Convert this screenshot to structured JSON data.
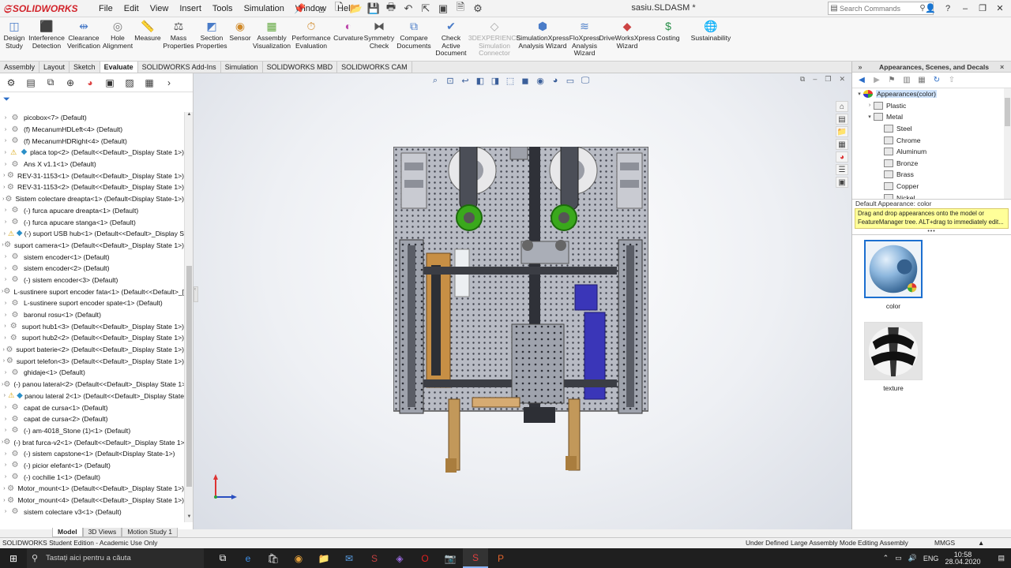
{
  "app": {
    "logo_text": "SOLIDWORKS",
    "document_title": "sasiu.SLDASM *",
    "menu": [
      "File",
      "Edit",
      "View",
      "Insert",
      "Tools",
      "Simulation",
      "Window",
      "Help"
    ],
    "search_placeholder": "Search Commands"
  },
  "ribbon": {
    "buttons": [
      {
        "label": "Design Study",
        "icon": "design-study-icon"
      },
      {
        "label": "Interference Detection",
        "icon": "interference-icon"
      },
      {
        "label": "Clearance Verification",
        "icon": "clearance-icon"
      },
      {
        "label": "Hole Alignment",
        "icon": "hole-icon"
      },
      {
        "label": "Measure",
        "icon": "measure-icon"
      },
      {
        "label": "Mass Properties",
        "icon": "mass-icon"
      },
      {
        "label": "Section Properties",
        "icon": "section-icon"
      },
      {
        "label": "Sensor",
        "icon": "sensor-icon"
      },
      {
        "label": "Assembly Visualization",
        "icon": "assembly-vis-icon"
      },
      {
        "label": "Performance Evaluation",
        "icon": "performance-icon"
      },
      {
        "label": "Curvature",
        "icon": "curvature-icon"
      },
      {
        "label": "Symmetry Check",
        "icon": "symmetry-icon"
      },
      {
        "label": "Compare Documents",
        "icon": "compare-icon"
      },
      {
        "label": "Check Active Document",
        "icon": "check-icon"
      },
      {
        "label": "3DEXPERIENCE Simulation Connector",
        "icon": "3dx-icon",
        "disabled": true
      },
      {
        "label": "SimulationXpress Analysis Wizard",
        "icon": "simxpress-icon"
      },
      {
        "label": "FloXpress Analysis Wizard",
        "icon": "floxpress-icon"
      },
      {
        "label": "DriveWorksXpress Wizard",
        "icon": "driveworks-icon"
      },
      {
        "label": "Costing",
        "icon": "costing-icon"
      },
      {
        "label": "Sustainability",
        "icon": "sustainability-icon"
      }
    ]
  },
  "tabs": [
    "Assembly",
    "Layout",
    "Sketch",
    "Evaluate",
    "SOLIDWORKS Add-Ins",
    "Simulation",
    "SOLIDWORKS MBD",
    "SOLIDWORKS CAM"
  ],
  "active_tab": "Evaluate",
  "feature_tree": [
    {
      "text": "picobox<7> (Default)"
    },
    {
      "text": "(f) MecanumHDLeft<4> (Default)"
    },
    {
      "text": "(f) MecanumHDRight<4> (Default)"
    },
    {
      "text": "placa top<2> (Default<<Default>_Display State 1>)",
      "warn": true,
      "disp": true
    },
    {
      "text": "Ans X v1.1<1> (Default)"
    },
    {
      "text": "REV-31-1153<1> (Default<<Default>_Display State 1>)"
    },
    {
      "text": "REV-31-1153<2> (Default<<Default>_Display State 1>)"
    },
    {
      "text": "Sistem colectare dreapta<1> (Default<Display State-1>)"
    },
    {
      "text": "(-) furca apucare dreapta<1> (Default)"
    },
    {
      "text": "(-) furca apucare stanga<1> (Default)"
    },
    {
      "text": "(-) suport USB hub<1> (Default<<Default>_Display S",
      "warn": true,
      "disp": true
    },
    {
      "text": "suport camera<1> (Default<<Default>_Display State 1>)"
    },
    {
      "text": "sistem encoder<1> (Default)"
    },
    {
      "text": "sistem encoder<2> (Default)"
    },
    {
      "text": "(-) sistem encoder<3> (Default)"
    },
    {
      "text": "L-sustinere suport encoder fata<1> (Default<<Default>_[]"
    },
    {
      "text": "L-sustinere suport encoder spate<1> (Default)"
    },
    {
      "text": "baronul rosu<1> (Default)"
    },
    {
      "text": "suport hub1<3> (Default<<Default>_Display State 1>)"
    },
    {
      "text": "suport hub2<2> (Default<<Default>_Display State 1>)"
    },
    {
      "text": "suport baterie<2> (Default<<Default>_Display State 1>)"
    },
    {
      "text": "suport telefon<3> (Default<<Default>_Display State 1>)"
    },
    {
      "text": "ghidaje<1> (Default)"
    },
    {
      "text": "(-) panou lateral<2> (Default<<Default>_Display State 1>"
    },
    {
      "text": "panou lateral 2<1> (Default<<Default>_Display State",
      "warn": true,
      "disp": true
    },
    {
      "text": "capat de cursa<1> (Default)"
    },
    {
      "text": "capat de cursa<2> (Default)"
    },
    {
      "text": "(-) am-4018_Stone (1)<1> (Default)"
    },
    {
      "text": "(-) brat furca-v2<1> (Default<<Default>_Display State 1>)"
    },
    {
      "text": "(-) sistem capstone<1> (Default<Display State-1>)"
    },
    {
      "text": "(-) picior elefant<1> (Default)"
    },
    {
      "text": "(-) cochilie 1<1> (Default)"
    },
    {
      "text": "Motor_mount<1> (Default<<Default>_Display State 1>)"
    },
    {
      "text": "Motor_mount<4> (Default<<Default>_Display State 1>)"
    },
    {
      "text": "sistem colectare v3<1> (Default)"
    }
  ],
  "bottom_tabs": [
    "Model",
    "3D Views",
    "Motion Study 1"
  ],
  "task_pane": {
    "title": "Appearances, Scenes, and Decals",
    "tree": [
      {
        "label": "Appearances(color)",
        "level": 0,
        "expander": "▾",
        "root": true,
        "selected": true
      },
      {
        "label": "Plastic",
        "level": 1,
        "expander": "›"
      },
      {
        "label": "Metal",
        "level": 1,
        "expander": "▾"
      },
      {
        "label": "Steel",
        "level": 2,
        "expander": ""
      },
      {
        "label": "Chrome",
        "level": 2,
        "expander": ""
      },
      {
        "label": "Aluminum",
        "level": 2,
        "expander": ""
      },
      {
        "label": "Bronze",
        "level": 2,
        "expander": ""
      },
      {
        "label": "Brass",
        "level": 2,
        "expander": ""
      },
      {
        "label": "Copper",
        "level": 2,
        "expander": ""
      },
      {
        "label": "Nickel",
        "level": 2,
        "expander": ""
      }
    ],
    "default_appearance": "Default Appearance: color",
    "tooltip": "Drag and drop appearances onto the model or FeatureManager tree.  ALT+drag to immediately edit...",
    "swatches": [
      {
        "label": "color"
      },
      {
        "label": "texture"
      }
    ]
  },
  "status": {
    "edition": "SOLIDWORKS Student Edition - Academic Use Only",
    "items": [
      "Under Defined",
      "Large Assembly Mode",
      "Editing Assembly",
      "MMGS"
    ]
  },
  "taskbar": {
    "search_text": "Tastați aici pentru a căuta",
    "language": "ENG",
    "time": "10:58",
    "date": "28.04.2020"
  }
}
